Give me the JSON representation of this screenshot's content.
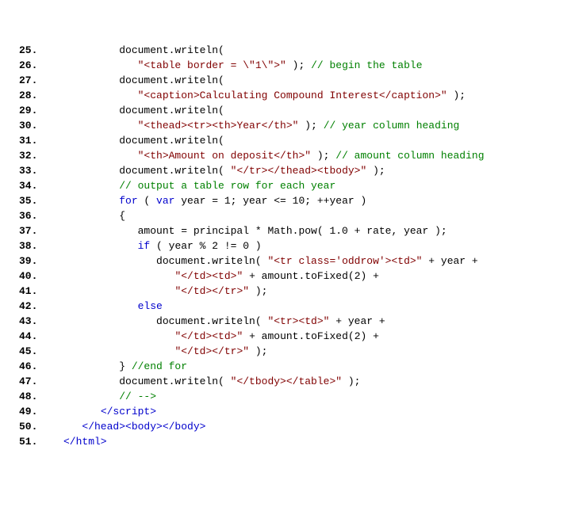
{
  "lines": [
    {
      "n": "25.",
      "seg": [
        [
          "p",
          "         document.writeln("
        ]
      ]
    },
    {
      "n": "26.",
      "seg": [
        [
          "p",
          "            "
        ],
        [
          "br",
          "\"<table border = \\\"1\\\">\""
        ],
        [
          "p",
          " ); "
        ],
        [
          "cm",
          "// begin the table"
        ]
      ]
    },
    {
      "n": "27.",
      "seg": [
        [
          "p",
          "         document.writeln("
        ]
      ]
    },
    {
      "n": "28.",
      "seg": [
        [
          "p",
          "            "
        ],
        [
          "br",
          "\"<caption>Calculating Compound Interest</caption>\""
        ],
        [
          "p",
          " );"
        ]
      ]
    },
    {
      "n": "29.",
      "seg": [
        [
          "p",
          "         document.writeln("
        ]
      ]
    },
    {
      "n": "30.",
      "seg": [
        [
          "p",
          "            "
        ],
        [
          "br",
          "\"<thead><tr><th>Year</th>\""
        ],
        [
          "p",
          " ); "
        ],
        [
          "cm",
          "// year column heading"
        ]
      ]
    },
    {
      "n": "31.",
      "seg": [
        [
          "p",
          "         document.writeln("
        ]
      ]
    },
    {
      "n": "32.",
      "seg": [
        [
          "p",
          "            "
        ],
        [
          "br",
          "\"<th>Amount on deposit</th>\""
        ],
        [
          "p",
          " ); "
        ],
        [
          "cm",
          "// amount column heading"
        ]
      ]
    },
    {
      "n": "33.",
      "seg": [
        [
          "p",
          "         document.writeln( "
        ],
        [
          "br",
          "\"</tr></thead><tbody>\""
        ],
        [
          "p",
          " );"
        ]
      ]
    },
    {
      "n": "34.",
      "seg": [
        [
          "p",
          "         "
        ],
        [
          "cm",
          "// output a table row for each year"
        ]
      ]
    },
    {
      "n": "35.",
      "seg": [
        [
          "p",
          "         "
        ],
        [
          "kw",
          "for"
        ],
        [
          "p",
          " ( "
        ],
        [
          "kw",
          "var"
        ],
        [
          "p",
          " year = 1; year <= 10; ++year )"
        ]
      ]
    },
    {
      "n": "36.",
      "seg": [
        [
          "p",
          "         {"
        ]
      ]
    },
    {
      "n": "37.",
      "seg": [
        [
          "p",
          "            amount = principal * Math.pow( 1.0 + rate, year );"
        ]
      ]
    },
    {
      "n": "38.",
      "seg": [
        [
          "p",
          "            "
        ],
        [
          "kw",
          "if"
        ],
        [
          "p",
          " ( year % 2 != 0 )"
        ]
      ]
    },
    {
      "n": "39.",
      "seg": [
        [
          "p",
          "               document.writeln( "
        ],
        [
          "br",
          "\"<tr class='oddrow'><td>\""
        ],
        [
          "p",
          " + year +"
        ]
      ]
    },
    {
      "n": "40.",
      "seg": [
        [
          "p",
          "                  "
        ],
        [
          "br",
          "\"</td><td>\""
        ],
        [
          "p",
          " + amount.toFixed(2) +"
        ]
      ]
    },
    {
      "n": "41.",
      "seg": [
        [
          "p",
          "                  "
        ],
        [
          "br",
          "\"</td></tr>\""
        ],
        [
          "p",
          " );"
        ]
      ]
    },
    {
      "n": "42.",
      "seg": [
        [
          "p",
          "            "
        ],
        [
          "kw",
          "else"
        ]
      ]
    },
    {
      "n": "43.",
      "seg": [
        [
          "p",
          "               document.writeln( "
        ],
        [
          "br",
          "\"<tr><td>\""
        ],
        [
          "p",
          " + year +"
        ]
      ]
    },
    {
      "n": "44.",
      "seg": [
        [
          "p",
          "                  "
        ],
        [
          "br",
          "\"</td><td>\""
        ],
        [
          "p",
          " + amount.toFixed(2) +"
        ]
      ]
    },
    {
      "n": "45.",
      "seg": [
        [
          "p",
          "                  "
        ],
        [
          "br",
          "\"</td></tr>\""
        ],
        [
          "p",
          " );"
        ]
      ]
    },
    {
      "n": "46.",
      "seg": [
        [
          "p",
          "         } "
        ],
        [
          "cm",
          "//end for"
        ]
      ]
    },
    {
      "n": "47.",
      "seg": [
        [
          "p",
          "         document.writeln( "
        ],
        [
          "br",
          "\"</tbody></table>\""
        ],
        [
          "p",
          " );"
        ]
      ]
    },
    {
      "n": "48.",
      "seg": [
        [
          "p",
          "         "
        ],
        [
          "cm",
          "// -->"
        ]
      ]
    },
    {
      "n": "49.",
      "seg": [
        [
          "p",
          "      "
        ],
        [
          "kw",
          "</script>"
        ]
      ]
    },
    {
      "n": "50.",
      "seg": [
        [
          "p",
          "   "
        ],
        [
          "kw",
          "</head><body></body>"
        ]
      ]
    },
    {
      "n": "51.",
      "seg": [
        [
          "kw",
          "</html>"
        ]
      ]
    }
  ]
}
